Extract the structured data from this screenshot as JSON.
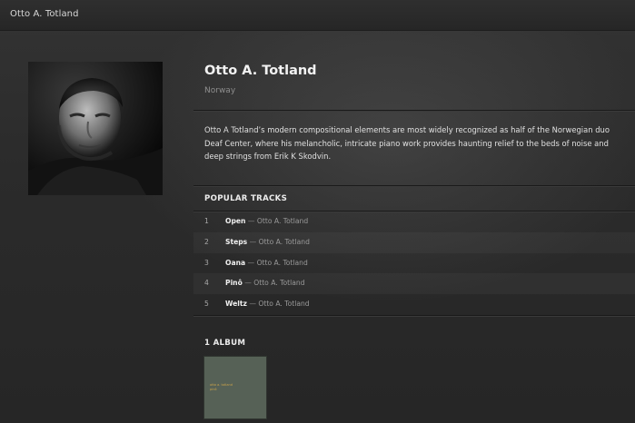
{
  "window": {
    "title": "Otto A. Totland"
  },
  "artist": {
    "name": "Otto A. Totland",
    "country": "Norway",
    "bio": "Otto A Totland’s modern compositional elements are most widely recognized as half of the Norwegian duo Deaf Center, where his melancholic, intricate piano work provides haunting relief to the beds of noise and deep strings from Erik K Skodvin."
  },
  "popular_tracks": {
    "heading": "POPULAR TRACKS",
    "separator": "—",
    "items": [
      {
        "num": "1",
        "title": "Open",
        "artist": "Otto A. Totland"
      },
      {
        "num": "2",
        "title": "Steps",
        "artist": "Otto A. Totland"
      },
      {
        "num": "3",
        "title": "Oana",
        "artist": "Otto A. Totland"
      },
      {
        "num": "4",
        "title": "Pinô",
        "artist": "Otto A. Totland"
      },
      {
        "num": "5",
        "title": "Weltz",
        "artist": "Otto A. Totland"
      }
    ]
  },
  "albums": {
    "heading": "1 ALBUM",
    "cover_text_line1": "otto a. totland",
    "cover_text_line2": "pinô"
  },
  "colors": {
    "background": "#2a2a2a",
    "album_cover": "#566156",
    "album_text": "#c9a24a"
  },
  "icons": {
    "artist_photo": "artist-portrait"
  }
}
